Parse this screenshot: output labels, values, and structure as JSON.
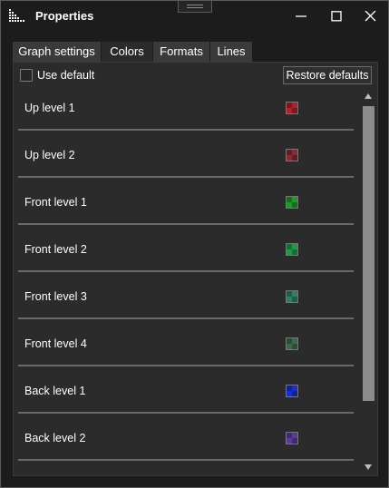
{
  "window": {
    "title": "Properties",
    "icons": {
      "app": "grid-dots-icon",
      "minimize": "minimize-icon",
      "maximize": "maximize-icon",
      "close": "close-icon",
      "grip": "drag-grip-icon"
    }
  },
  "tabs": [
    {
      "label": "Graph settings",
      "selected": false
    },
    {
      "label": "Colors",
      "selected": true
    },
    {
      "label": "Formats",
      "selected": false
    },
    {
      "label": "Lines",
      "selected": false
    }
  ],
  "colors_panel": {
    "use_default_label": "Use default",
    "use_default_checked": false,
    "restore_label": "Restore defaults",
    "items": [
      {
        "label": "Up level 1",
        "color": "#b0202e"
      },
      {
        "label": "Up level 2",
        "color": "#8a2a34"
      },
      {
        "label": "Front level 1",
        "color": "#1f9a2a"
      },
      {
        "label": "Front level 2",
        "color": "#1f9a48"
      },
      {
        "label": "Front level 3",
        "color": "#2e8060"
      },
      {
        "label": "Front level 4",
        "color": "#3d6a4a"
      },
      {
        "label": "Back level 1",
        "color": "#1a2fd0"
      },
      {
        "label": "Back level 2",
        "color": "#5a3a9a"
      }
    ]
  },
  "scrollbar": {
    "up_icon": "arrow-up-icon",
    "down_icon": "arrow-down-icon"
  }
}
